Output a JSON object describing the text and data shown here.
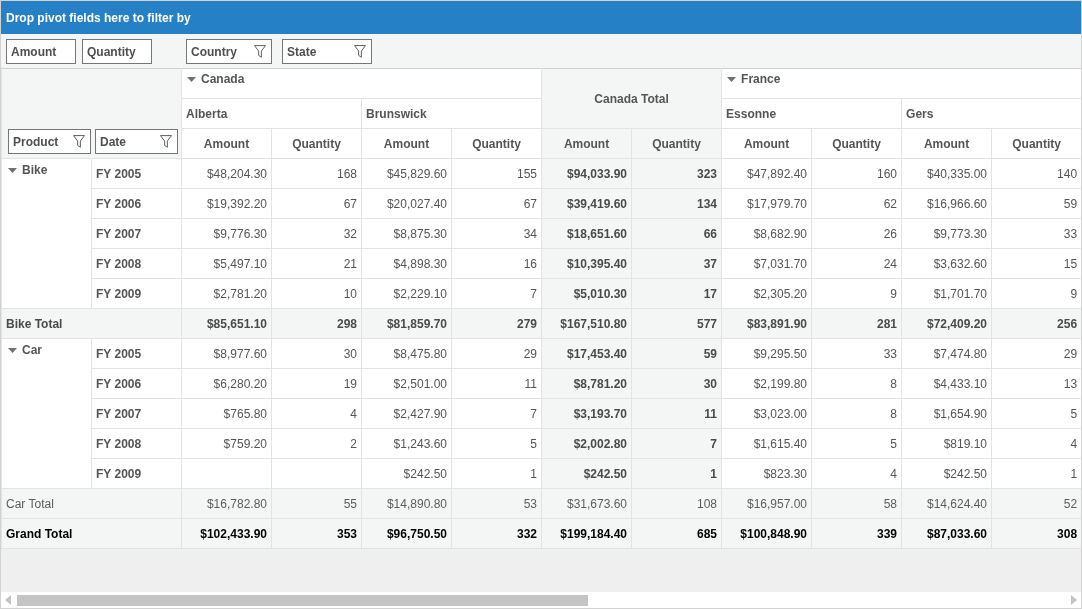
{
  "drop_zone": {
    "title": "Drop pivot fields here to filter by"
  },
  "value_fields": [
    {
      "label": "Amount"
    },
    {
      "label": "Quantity"
    }
  ],
  "column_fields": [
    {
      "label": "Country"
    },
    {
      "label": "State"
    }
  ],
  "row_fields": [
    {
      "label": "Product"
    },
    {
      "label": "Date"
    }
  ],
  "pivot": {
    "column_groups": [
      {
        "kind": "group",
        "label": "Canada",
        "expanded": true,
        "children": [
          {
            "label": "Alberta",
            "measures": [
              "Amount",
              "Quantity"
            ]
          },
          {
            "label": "Brunswick",
            "measures": [
              "Amount",
              "Quantity"
            ]
          }
        ]
      },
      {
        "kind": "total",
        "label": "Canada Total",
        "measures": [
          "Amount",
          "Quantity"
        ]
      },
      {
        "kind": "group",
        "label": "France",
        "expanded": true,
        "children": [
          {
            "label": "Essonne",
            "measures": [
              "Amount",
              "Quantity"
            ]
          },
          {
            "label": "Gers",
            "measures": [
              "Amount",
              "Quantity"
            ]
          }
        ]
      }
    ],
    "row_groups": [
      {
        "label": "Bike",
        "expanded": true,
        "rows": [
          {
            "label": "FY 2005",
            "cells": [
              "$48,204.30",
              "168",
              "$45,829.60",
              "155",
              "$94,033.90",
              "323",
              "$47,892.40",
              "160",
              "$40,335.00",
              "140"
            ]
          },
          {
            "label": "FY 2006",
            "cells": [
              "$19,392.20",
              "67",
              "$20,027.40",
              "67",
              "$39,419.60",
              "134",
              "$17,979.70",
              "62",
              "$16,966.60",
              "59"
            ]
          },
          {
            "label": "FY 2007",
            "cells": [
              "$9,776.30",
              "32",
              "$8,875.30",
              "34",
              "$18,651.60",
              "66",
              "$8,682.90",
              "26",
              "$9,773.30",
              "33"
            ]
          },
          {
            "label": "FY 2008",
            "cells": [
              "$5,497.10",
              "21",
              "$4,898.30",
              "16",
              "$10,395.40",
              "37",
              "$7,031.70",
              "24",
              "$3,632.60",
              "15"
            ]
          },
          {
            "label": "FY 2009",
            "cells": [
              "$2,781.20",
              "10",
              "$2,229.10",
              "7",
              "$5,010.30",
              "17",
              "$2,305.20",
              "9",
              "$1,701.70",
              "9"
            ]
          }
        ],
        "total": {
          "label": "Bike Total",
          "emphasized": true,
          "cells": [
            "$85,651.10",
            "298",
            "$81,859.70",
            "279",
            "$167,510.80",
            "577",
            "$83,891.90",
            "281",
            "$72,409.20",
            "256"
          ]
        }
      },
      {
        "label": "Car",
        "expanded": true,
        "rows": [
          {
            "label": "FY 2005",
            "cells": [
              "$8,977.60",
              "30",
              "$8,475.80",
              "29",
              "$17,453.40",
              "59",
              "$9,295.50",
              "33",
              "$7,474.80",
              "29"
            ]
          },
          {
            "label": "FY 2006",
            "cells": [
              "$6,280.20",
              "19",
              "$2,501.00",
              "11",
              "$8,781.20",
              "30",
              "$2,199.80",
              "8",
              "$4,433.10",
              "13"
            ]
          },
          {
            "label": "FY 2007",
            "cells": [
              "$765.80",
              "4",
              "$2,427.90",
              "7",
              "$3,193.70",
              "11",
              "$3,023.00",
              "8",
              "$1,654.90",
              "5"
            ]
          },
          {
            "label": "FY 2008",
            "cells": [
              "$759.20",
              "2",
              "$1,243.60",
              "5",
              "$2,002.80",
              "7",
              "$1,615.40",
              "5",
              "$819.10",
              "4"
            ]
          },
          {
            "label": "FY 2009",
            "cells": [
              null,
              null,
              "$242.50",
              "1",
              "$242.50",
              "1",
              "$823.30",
              "4",
              "$242.50",
              "1"
            ]
          }
        ],
        "total": {
          "label": "Car Total",
          "emphasized": false,
          "cells": [
            "$16,782.80",
            "55",
            "$14,890.80",
            "53",
            "$31,673.60",
            "108",
            "$16,957.00",
            "58",
            "$14,624.40",
            "52"
          ]
        }
      }
    ],
    "grand_total": {
      "label": "Grand Total",
      "cells": [
        "$102,433.90",
        "353",
        "$96,750.50",
        "332",
        "$199,184.40",
        "685",
        "$100,848.90",
        "339",
        "$87,033.60",
        "308"
      ]
    }
  }
}
